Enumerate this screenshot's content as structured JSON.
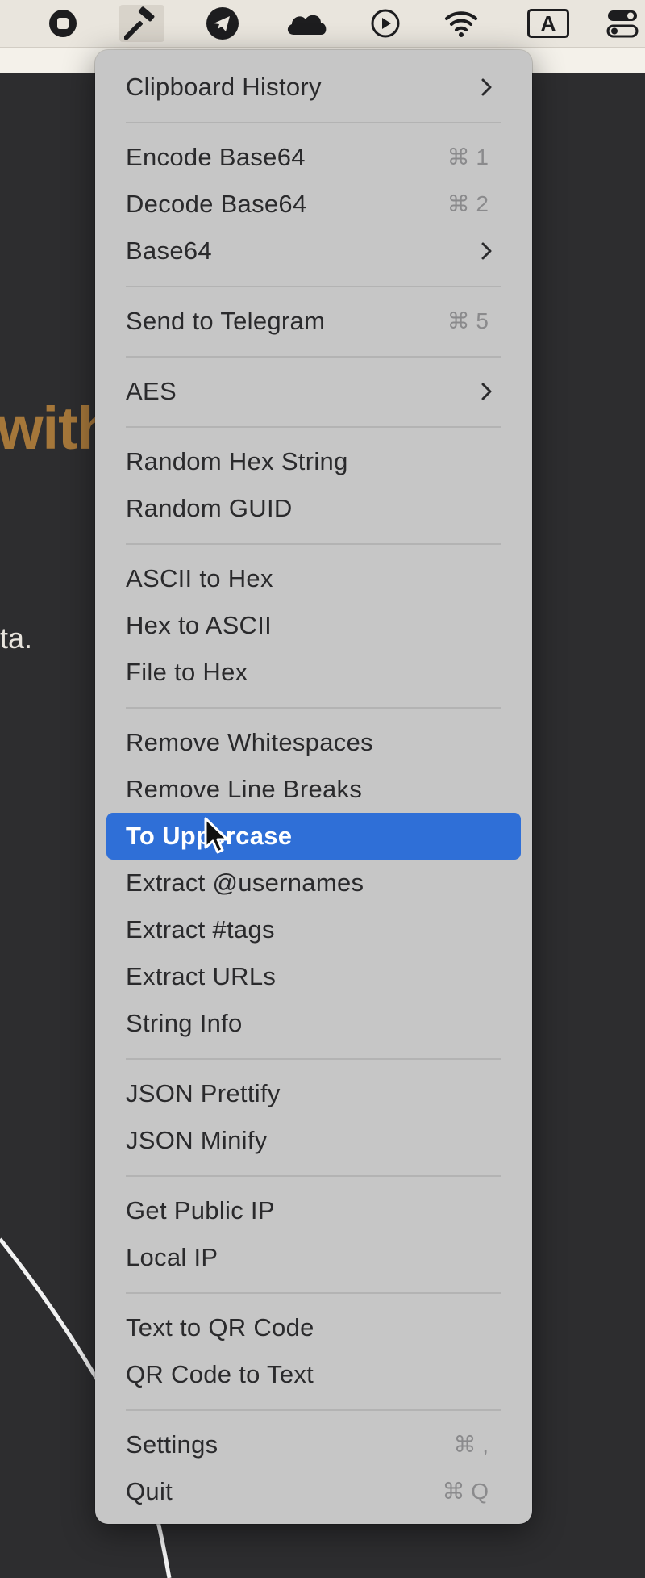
{
  "menubar": {
    "icons": [
      "stop-icon",
      "hammer-icon",
      "telegram-icon",
      "cloud-icon",
      "play-circle-icon",
      "wifi-icon",
      "input-source-icon",
      "control-center-icon"
    ],
    "input_source_label": "A",
    "active_icon": "hammer-icon"
  },
  "background": {
    "heading_fragment": "with",
    "body_fragment": "ta."
  },
  "menu": {
    "items": [
      {
        "label": "Clipboard History",
        "shortcut": "",
        "submenu": true
      },
      {
        "label": "Encode Base64",
        "shortcut": "⌘ 1",
        "submenu": false
      },
      {
        "label": "Decode Base64",
        "shortcut": "⌘ 2",
        "submenu": false
      },
      {
        "label": "Base64",
        "shortcut": "",
        "submenu": true
      },
      {
        "label": "Send to Telegram",
        "shortcut": "⌘ 5",
        "submenu": false
      },
      {
        "label": "AES",
        "shortcut": "",
        "submenu": true
      },
      {
        "label": "Random Hex String",
        "shortcut": "",
        "submenu": false
      },
      {
        "label": "Random GUID",
        "shortcut": "",
        "submenu": false
      },
      {
        "label": "ASCII to Hex",
        "shortcut": "",
        "submenu": false
      },
      {
        "label": "Hex to ASCII",
        "shortcut": "",
        "submenu": false
      },
      {
        "label": "File to Hex",
        "shortcut": "",
        "submenu": false
      },
      {
        "label": "Remove Whitespaces",
        "shortcut": "",
        "submenu": false
      },
      {
        "label": "Remove Line Breaks",
        "shortcut": "",
        "submenu": false
      },
      {
        "label": "To Uppercase",
        "shortcut": "",
        "submenu": false,
        "highlighted": true
      },
      {
        "label": "Extract @usernames",
        "shortcut": "",
        "submenu": false
      },
      {
        "label": "Extract #tags",
        "shortcut": "",
        "submenu": false
      },
      {
        "label": "Extract URLs",
        "shortcut": "",
        "submenu": false
      },
      {
        "label": "String Info",
        "shortcut": "",
        "submenu": false
      },
      {
        "label": "JSON Prettify",
        "shortcut": "",
        "submenu": false
      },
      {
        "label": "JSON Minify",
        "shortcut": "",
        "submenu": false
      },
      {
        "label": "Get Public IP",
        "shortcut": "",
        "submenu": false
      },
      {
        "label": "Local IP",
        "shortcut": "",
        "submenu": false
      },
      {
        "label": "Text to QR Code",
        "shortcut": "",
        "submenu": false
      },
      {
        "label": "QR Code to Text",
        "shortcut": "",
        "submenu": false
      },
      {
        "label": "Settings",
        "shortcut": "⌘ ,",
        "submenu": false
      },
      {
        "label": "Quit",
        "shortcut": "⌘ Q",
        "submenu": false
      }
    ],
    "highlight_color": "#2f6fd7",
    "background_color": "#c6c6c6"
  }
}
